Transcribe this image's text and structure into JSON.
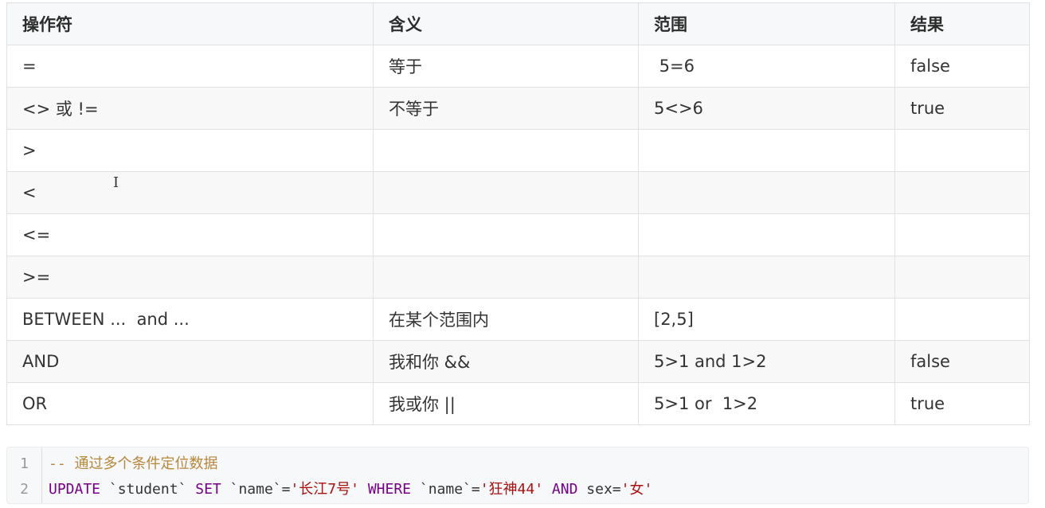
{
  "table": {
    "headers": [
      "操作符",
      "含义",
      "范围",
      "结果"
    ],
    "rows": [
      [
        "=",
        "等于",
        " 5=6",
        "false"
      ],
      [
        "<> 或 !=",
        "不等于",
        "5<>6",
        "true"
      ],
      [
        ">",
        "",
        "",
        ""
      ],
      [
        "<",
        "",
        "",
        ""
      ],
      [
        "<=",
        "",
        "",
        ""
      ],
      [
        ">=",
        "",
        "",
        ""
      ],
      [
        "BETWEEN ...  and ...",
        "在某个范围内",
        "[2,5]",
        ""
      ],
      [
        "AND",
        "我和你 &&",
        "5>1 and 1>2",
        "false"
      ],
      [
        "OR",
        "我或你 ||",
        "5>1 or  1>2",
        "true"
      ]
    ]
  },
  "code": {
    "line_numbers": [
      "1",
      "2"
    ],
    "line1": {
      "comment": "-- 通过多个条件定位数据"
    },
    "line2": {
      "kw_update": "UPDATE",
      "t1": " `student` ",
      "kw_set": "SET",
      "t2": " `name`=",
      "s1": "'长江7号'",
      "t3": " ",
      "kw_where": "WHERE",
      "t4": " `name`=",
      "s2": "'狂神44'",
      "t5": " ",
      "kw_and": "AND",
      "t6": " sex=",
      "s3": "'女'"
    }
  }
}
